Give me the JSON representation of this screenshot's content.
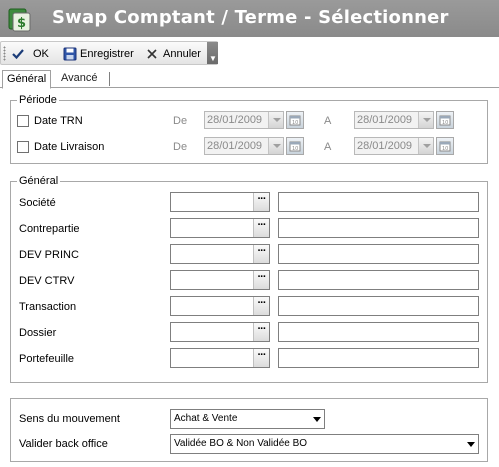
{
  "window": {
    "title": "Swap Comptant / Terme - Sélectionner",
    "icon": "swap-app-icon"
  },
  "toolbar": {
    "ok_label": "OK",
    "save_label": "Enregistrer",
    "cancel_label": "Annuler"
  },
  "tabs": [
    {
      "label": "Général",
      "active": true
    },
    {
      "label": "Avancé",
      "active": false
    }
  ],
  "periode": {
    "legend": "Période",
    "rows": [
      {
        "label": "Date TRN",
        "checked": false,
        "from_label": "De",
        "from_value": "28/01/2009",
        "to_label": "A",
        "to_value": "28/01/2009"
      },
      {
        "label": "Date Livraison",
        "checked": false,
        "from_label": "De",
        "from_value": "28/01/2009",
        "to_label": "A",
        "to_value": "28/01/2009"
      }
    ]
  },
  "general": {
    "legend": "Général",
    "lookup_button": "···",
    "fields": [
      {
        "label": "Société",
        "value": "",
        "description": ""
      },
      {
        "label": "Contrepartie",
        "value": "",
        "description": ""
      },
      {
        "label": "DEV PRINC",
        "value": "",
        "description": ""
      },
      {
        "label": "DEV CTRV",
        "value": "",
        "description": ""
      },
      {
        "label": "Transaction",
        "value": "",
        "description": ""
      },
      {
        "label": "Dossier",
        "value": "",
        "description": ""
      },
      {
        "label": "Portefeuille",
        "value": "",
        "description": ""
      }
    ]
  },
  "options": {
    "sens_label": "Sens du mouvement",
    "sens_value": "Achat & Vente",
    "backoffice_label": "Valider back office",
    "backoffice_value": "Validée BO & Non Validée BO"
  },
  "colors": {
    "titlebar": "#8f8f8f",
    "title_text": "#ffffff",
    "disabled_text": "#8a8a8a"
  }
}
